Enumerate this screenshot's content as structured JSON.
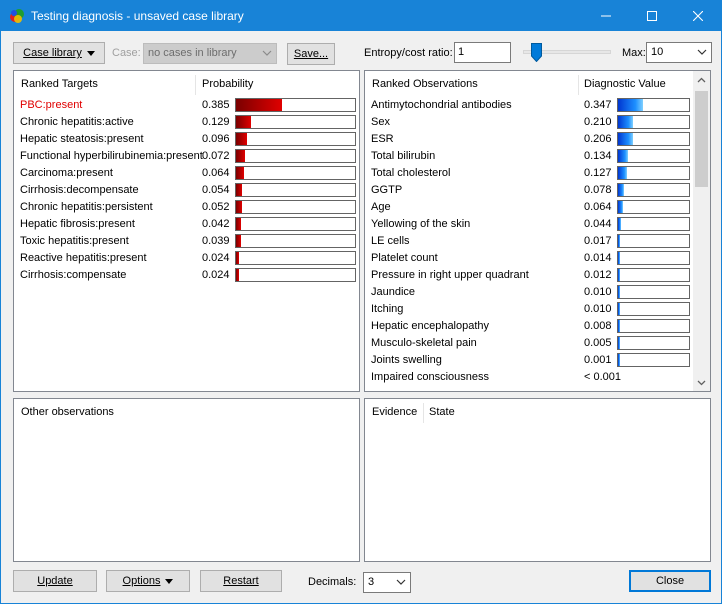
{
  "window": {
    "title": "Testing diagnosis - unsaved case library"
  },
  "toolbar": {
    "case_library_label": "Case library",
    "case_label": "Case:",
    "case_value": "no cases in library",
    "save_label": "Save...",
    "ratio_label": "Entropy/cost ratio:",
    "ratio_value": "1",
    "slider_value": 0.12,
    "max_label": "Max:",
    "max_value": "10"
  },
  "targets": {
    "header_name": "Ranked Targets",
    "header_value": "Probability",
    "accent_color": "#e00000",
    "rows": [
      {
        "name": "PBC:present",
        "value": "0.385",
        "fraction": 0.385,
        "highlight": true
      },
      {
        "name": "Chronic hepatitis:active",
        "value": "0.129",
        "fraction": 0.129
      },
      {
        "name": "Hepatic steatosis:present",
        "value": "0.096",
        "fraction": 0.096
      },
      {
        "name": "Functional hyperbilirubinemia:present",
        "value": "0.072",
        "fraction": 0.072
      },
      {
        "name": "Carcinoma:present",
        "value": "0.064",
        "fraction": 0.064
      },
      {
        "name": "Cirrhosis:decompensate",
        "value": "0.054",
        "fraction": 0.054
      },
      {
        "name": "Chronic hepatitis:persistent",
        "value": "0.052",
        "fraction": 0.052
      },
      {
        "name": "Hepatic fibrosis:present",
        "value": "0.042",
        "fraction": 0.042
      },
      {
        "name": "Toxic hepatitis:present",
        "value": "0.039",
        "fraction": 0.039
      },
      {
        "name": "Reactive hepatitis:present",
        "value": "0.024",
        "fraction": 0.024
      },
      {
        "name": "Cirrhosis:compensate",
        "value": "0.024",
        "fraction": 0.024
      }
    ]
  },
  "observations": {
    "header_name": "Ranked Observations",
    "header_value": "Diagnostic Value",
    "rows": [
      {
        "name": "Antimytochondrial antibodies",
        "value": "0.347",
        "fraction": 0.347
      },
      {
        "name": "Sex",
        "value": "0.210",
        "fraction": 0.21
      },
      {
        "name": "ESR",
        "value": "0.206",
        "fraction": 0.206
      },
      {
        "name": "Total bilirubin",
        "value": "0.134",
        "fraction": 0.134
      },
      {
        "name": "Total cholesterol",
        "value": "0.127",
        "fraction": 0.127
      },
      {
        "name": "GGTP",
        "value": "0.078",
        "fraction": 0.078
      },
      {
        "name": "Age",
        "value": "0.064",
        "fraction": 0.064
      },
      {
        "name": "Yellowing of the skin",
        "value": "0.044",
        "fraction": 0.044
      },
      {
        "name": "LE cells",
        "value": "0.017",
        "fraction": 0.017
      },
      {
        "name": "Platelet count",
        "value": "0.014",
        "fraction": 0.014
      },
      {
        "name": "Pressure in right upper quadrant",
        "value": "0.012",
        "fraction": 0.012
      },
      {
        "name": "Jaundice",
        "value": "0.010",
        "fraction": 0.01
      },
      {
        "name": "Itching",
        "value": "0.010",
        "fraction": 0.01
      },
      {
        "name": "Hepatic encephalopathy",
        "value": "0.008",
        "fraction": 0.008
      },
      {
        "name": "Musculo-skeletal pain",
        "value": "0.005",
        "fraction": 0.005
      },
      {
        "name": "Joints swelling",
        "value": "0.001",
        "fraction": 0.001
      },
      {
        "name": "Impaired consciousness",
        "value": "< 0.001",
        "fraction": 0,
        "nobar": true
      }
    ]
  },
  "other_observations": {
    "header": "Other observations"
  },
  "evidence": {
    "header_evidence": "Evidence",
    "header_state": "State"
  },
  "bottom": {
    "update_label": "Update",
    "options_label": "Options",
    "restart_label": "Restart",
    "decimals_label": "Decimals:",
    "decimals_value": "3",
    "close_label": "Close"
  }
}
